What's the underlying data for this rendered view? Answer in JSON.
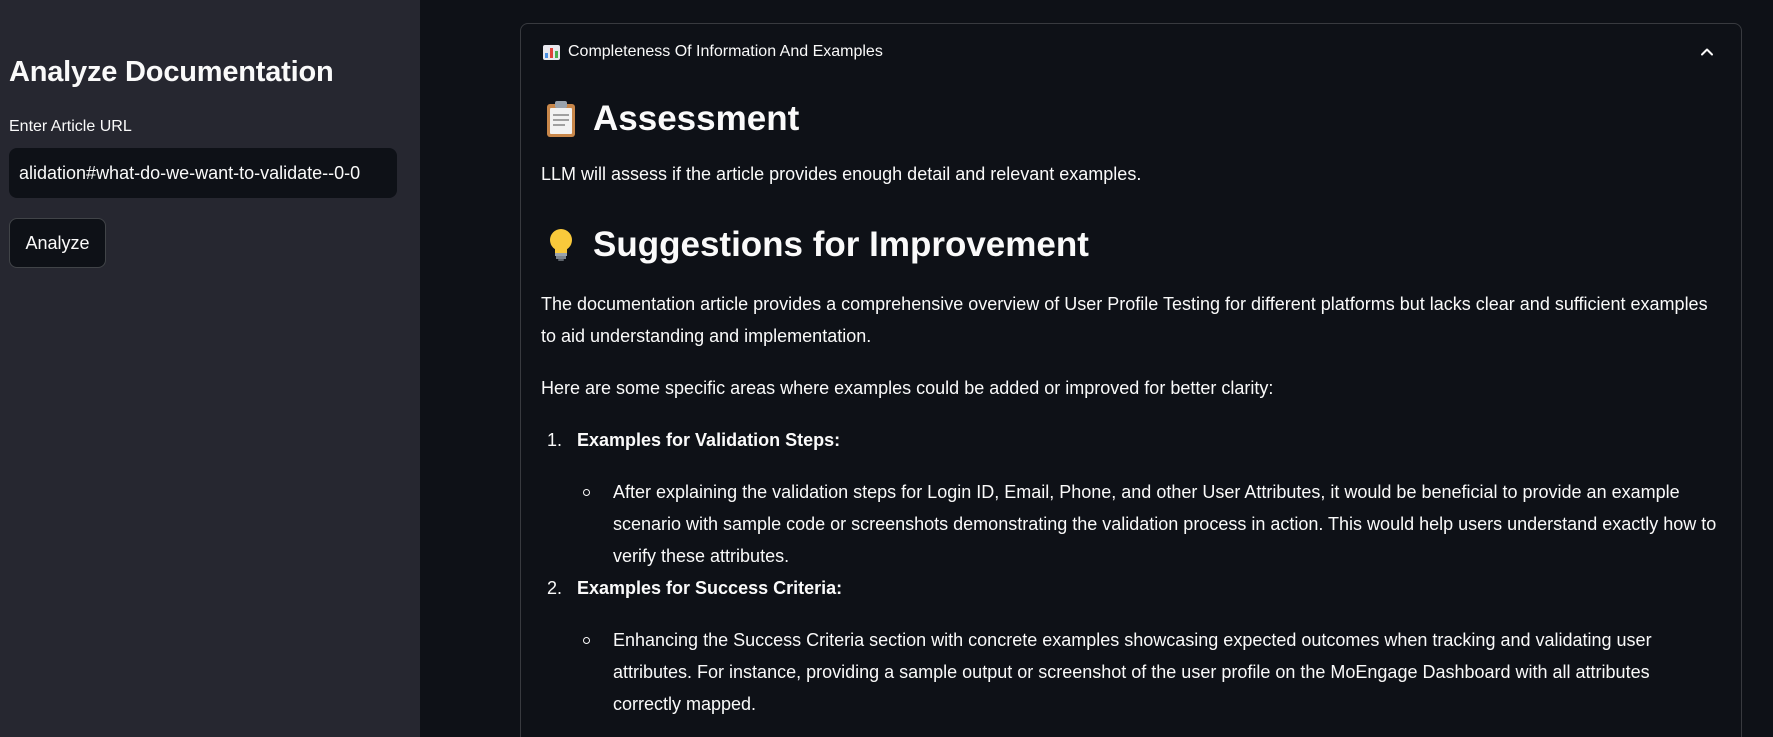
{
  "sidebar": {
    "title": "Analyze Documentation",
    "url_label": "Enter Article URL",
    "url_value": "alidation#what-do-we-want-to-validate--0-0",
    "analyze_label": "Analyze"
  },
  "expander": {
    "label": "Completeness Of Information And Examples",
    "icon": "bar-chart-icon",
    "toggle_icon": "chevron-up-icon"
  },
  "content": {
    "assessment_heading": "Assessment",
    "assessment_icon": "clipboard-icon",
    "assessment_text": "LLM will assess if the article provides enough detail and relevant examples.",
    "suggestions_heading": "Suggestions for Improvement",
    "suggestions_icon": "lightbulb-icon",
    "intro_text": "The documentation article provides a comprehensive overview of User Profile Testing for different platforms but lacks clear and sufficient examples to aid understanding and implementation.",
    "areas_text": "Here are some specific areas where examples could be added or improved for better clarity:",
    "items": [
      {
        "number": "1.",
        "title": "Examples for Validation Steps:",
        "bullet": "After explaining the validation steps for Login ID, Email, Phone, and other User Attributes, it would be beneficial to provide an example scenario with sample code or screenshots demonstrating the validation process in action. This would help users understand exactly how to verify these attributes."
      },
      {
        "number": "2.",
        "title": "Examples for Success Criteria:",
        "bullet": "Enhancing the Success Criteria section with concrete examples showcasing expected outcomes when tracking and validating user attributes. For instance, providing a sample output or screenshot of the user profile on the MoEngage Dashboard with all attributes correctly mapped."
      }
    ]
  },
  "colors": {
    "sidebar_bg": "#262730",
    "main_bg": "#0e1117",
    "text": "#fafafa"
  }
}
